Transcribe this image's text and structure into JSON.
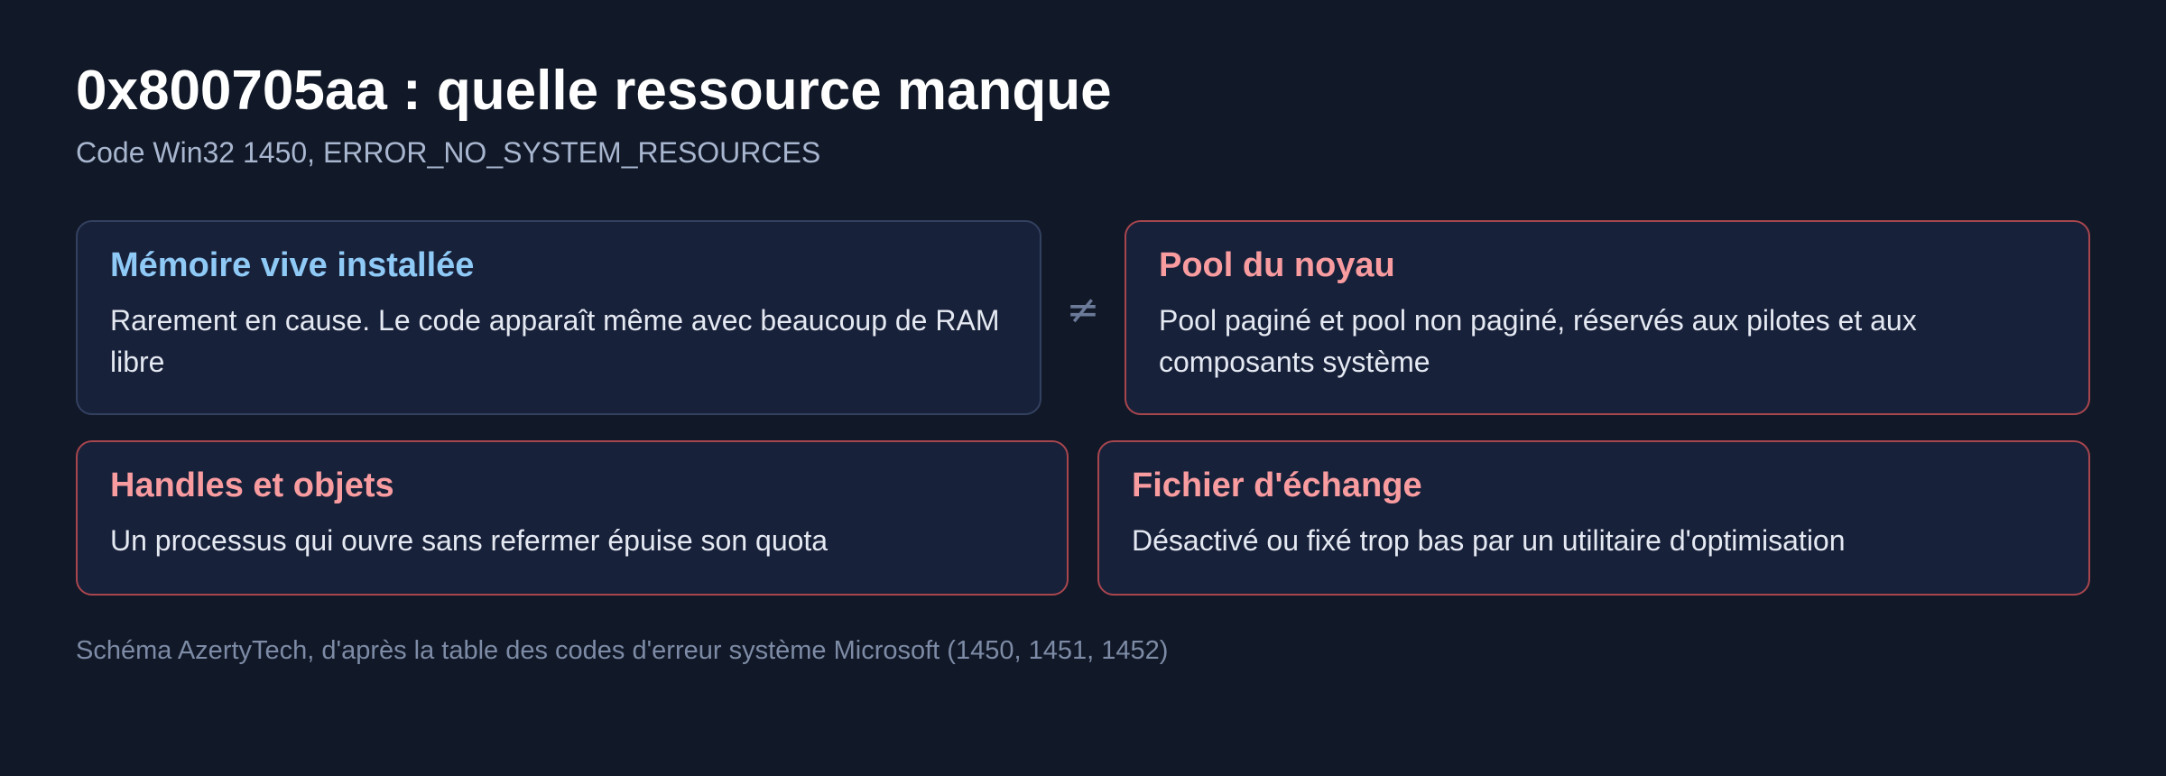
{
  "header": {
    "title": "0x800705aa : quelle ressource manque",
    "subtitle": "Code Win32 1450, ERROR_NO_SYSTEM_RESOURCES"
  },
  "cards": [
    {
      "title": "Mémoire vive installée",
      "text": "Rarement en cause. Le code apparaît même avec beaucoup de RAM libre"
    },
    {
      "title": "Pool du noyau",
      "text": "Pool paginé et pool non paginé, réservés aux pilotes et aux composants système"
    },
    {
      "title": "Handles et objets",
      "text": "Un processus qui ouvre sans refermer épuise son quota"
    },
    {
      "title": "Fichier d'échange",
      "text": "Désactivé ou fixé trop bas par un utilitaire d'optimisation"
    }
  ],
  "connector": {
    "symbol": "≠"
  },
  "footer": {
    "caption": "Schéma AzertyTech, d'après la table des codes d'erreur système Microsoft (1450, 1451, 1452)"
  },
  "colors": {
    "background": "#111827",
    "card_background": "#18213a",
    "neutral_border": "#334160",
    "alert_border": "#a8464e",
    "neutral_title": "#8fcaf7",
    "alert_title": "#f99ca0"
  }
}
